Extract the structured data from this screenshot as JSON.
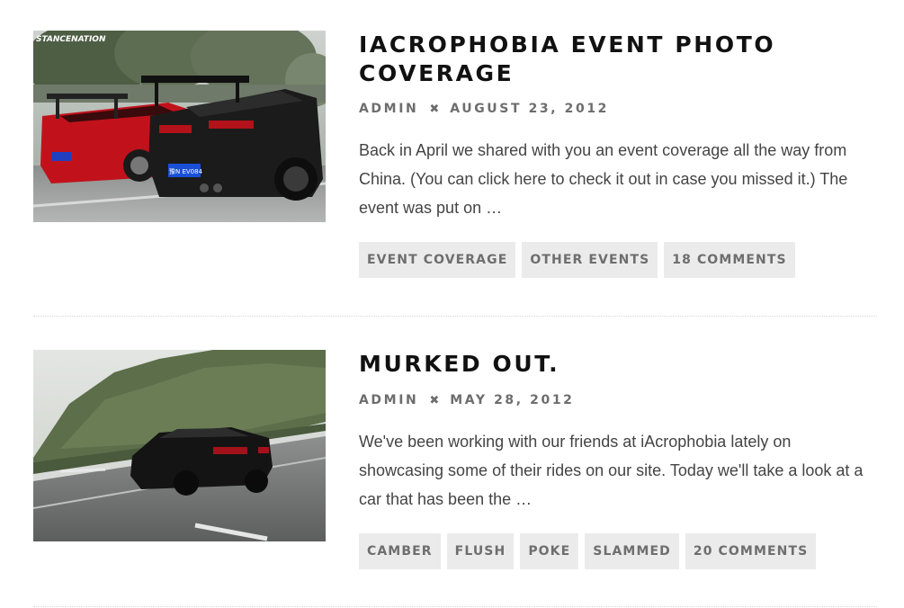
{
  "posts": [
    {
      "image_alt": "black and red sedans with large rear wings parked at an event",
      "watermark": "STANCENATION",
      "plate": "豫N EV084",
      "title": "iAcrophobia Event Photo Coverage",
      "author": "Admin",
      "separator": "✖",
      "date": "August 23, 2012",
      "excerpt": "Back in April we shared with you an event coverage all the way from China. (You can click here to check it out in case you missed it.) The event was put on …",
      "tags": [
        "Event Coverage",
        "Other Events",
        "18 Comments"
      ]
    },
    {
      "image_alt": "black lowered sedan driving on a mountain road",
      "title": "Murked Out.",
      "author": "Admin",
      "separator": "✖",
      "date": "May 28, 2012",
      "excerpt": "We've been working with our friends at iAcrophobia lately on showcasing some of their rides on our site. Today we'll take a look at a car that has been the …",
      "tags": [
        "Camber",
        "Flush",
        "Poke",
        "Slammed",
        "20 Comments"
      ]
    }
  ],
  "colors": {
    "title": "#111111",
    "meta": "#6d6d6d",
    "excerpt": "#444444",
    "tag_bg": "#ebebeb",
    "tag_text": "#6e6e6e",
    "divider": "#d6d6d6"
  }
}
